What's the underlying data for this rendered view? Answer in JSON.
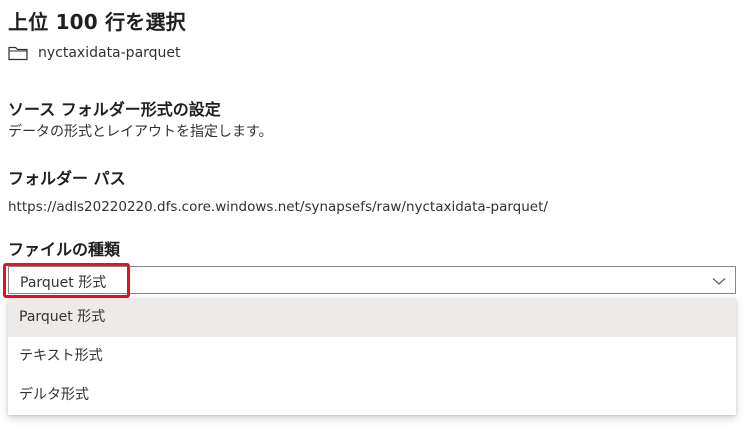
{
  "header": {
    "title": "上位 100 行を選択"
  },
  "folder": {
    "icon": "folder-icon",
    "name": "nyctaxidata-parquet"
  },
  "source_format": {
    "heading": "ソース フォルダー形式の設定",
    "description": "データの形式とレイアウトを指定します。"
  },
  "folder_path": {
    "label": "フォルダー パス",
    "value": "https://adls20220220.dfs.core.windows.net/synapsefs/raw/nyctaxidata-parquet/"
  },
  "file_type": {
    "label": "ファイルの種類",
    "selected": "Parquet 形式",
    "chevron_icon": "chevron-down-icon",
    "options": [
      {
        "label": "Parquet 形式",
        "selected": true
      },
      {
        "label": "テキスト形式",
        "selected": false
      },
      {
        "label": "デルタ形式",
        "selected": false
      }
    ]
  },
  "colors": {
    "highlight": "#e81123",
    "selected_option_bg": "#edebe9",
    "border": "#8a8886"
  }
}
